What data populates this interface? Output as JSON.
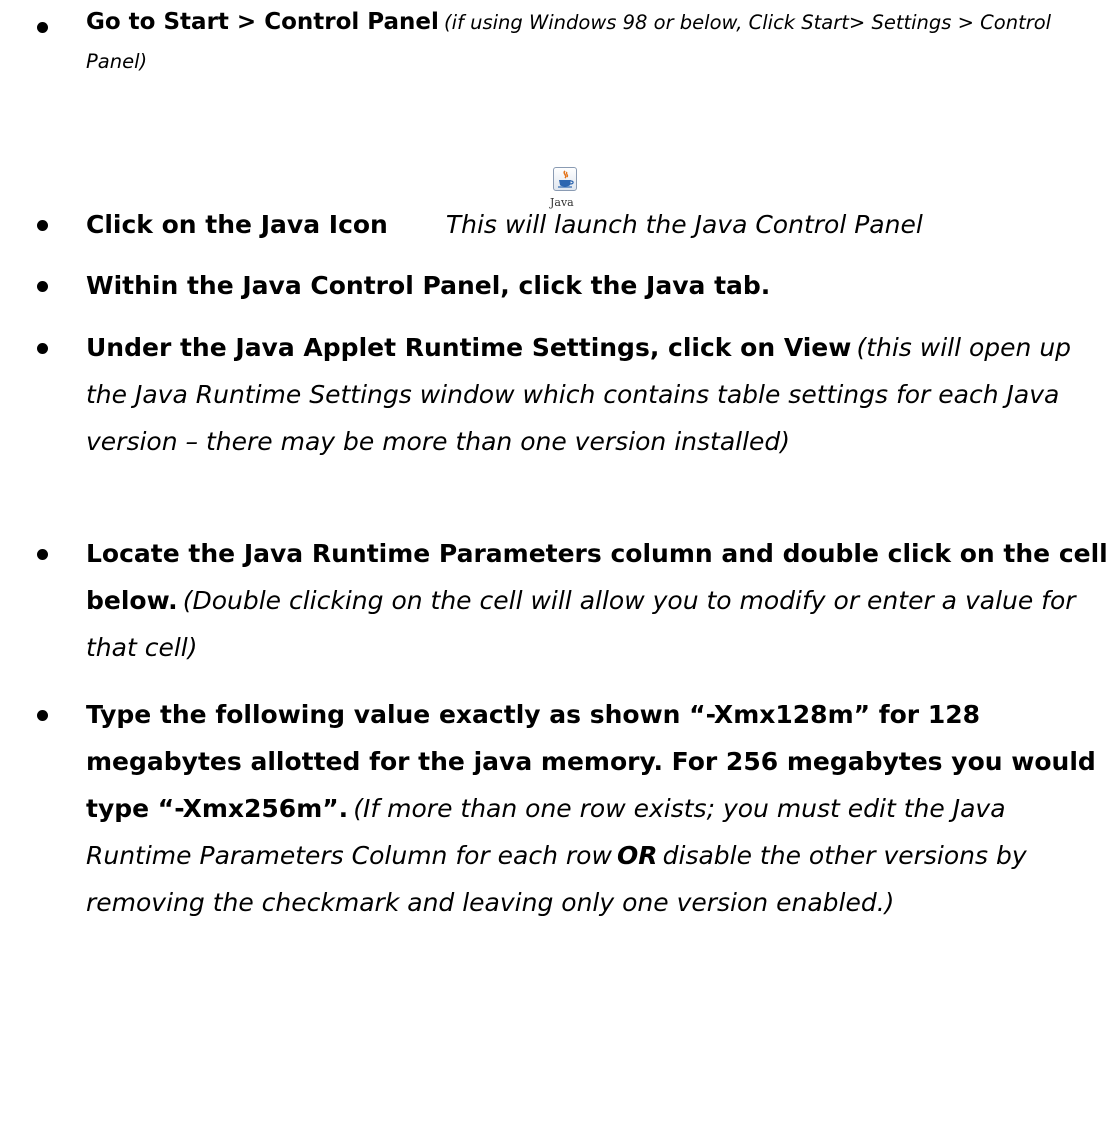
{
  "steps": [
    {
      "bold": "Go to Start > Control Panel",
      "italic": "(if using Windows 98 or below, Click Start> Settings > Control Panel)"
    },
    {
      "bold": "Click on the Java Icon",
      "icon_label": "Java",
      "italic": "This will launch the Java Control Panel"
    },
    {
      "bold": "Within the Java Control Panel, click the Java tab."
    },
    {
      "bold": "Under the Java Applet Runtime Settings, click on View",
      "italic": "(this will open up the Java Runtime Settings window which contains table settings for each Java version – there may be more than one version installed)"
    },
    {
      "bold": "Locate the Java Runtime Parameters column and double click on the cell below.",
      "italic": "(Double clicking on the cell will allow you to modify or enter a value for that cell)"
    },
    {
      "bold": "Type the following value exactly as shown “-Xmx128m” for 128 megabytes allotted for the java memory.  For 256 megabytes you would type “-Xmx256m”.",
      "italic_before": "(If more than one row exists; you must edit the Java Runtime Parameters Column for each row",
      "bold_italic": "OR",
      "italic_after": "disable the other versions by removing the checkmark and leaving only one version enabled.)"
    }
  ],
  "icons": {
    "java": "java-coffee-cup-icon"
  }
}
